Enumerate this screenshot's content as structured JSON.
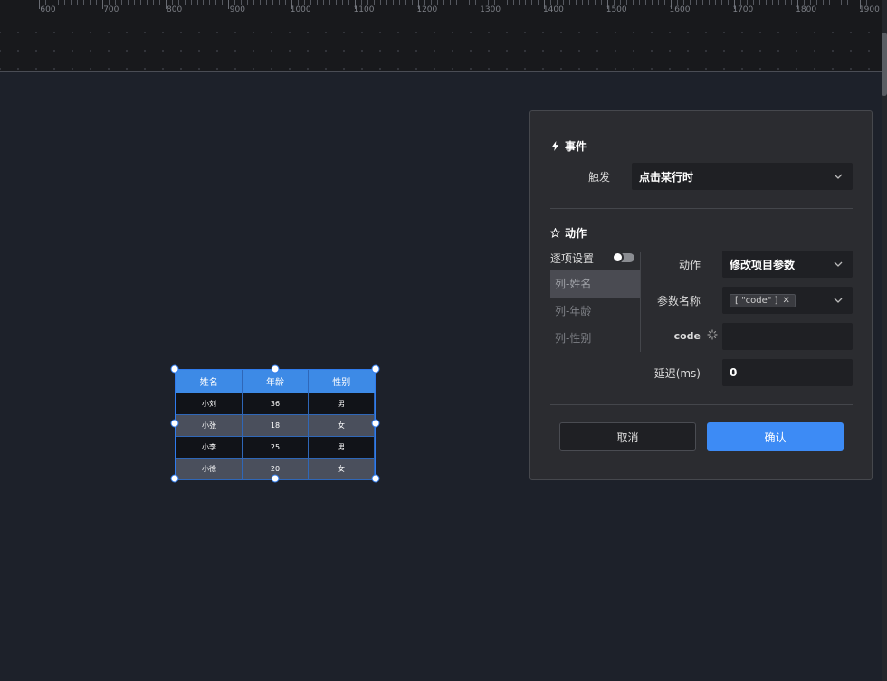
{
  "ruler": {
    "labels": [
      "600",
      "700",
      "800",
      "900",
      "1000",
      "1100",
      "1200",
      "1300",
      "1400",
      "1500",
      "1600",
      "1700",
      "1800",
      "1900"
    ]
  },
  "table_widget": {
    "headers": [
      "姓名",
      "年龄",
      "性别"
    ],
    "rows": [
      [
        "小刘",
        "36",
        "男"
      ],
      [
        "小张",
        "18",
        "女"
      ],
      [
        "小李",
        "25",
        "男"
      ],
      [
        "小徐",
        "20",
        "女"
      ]
    ]
  },
  "dialog": {
    "event_title": "事件",
    "trigger_label": "触发",
    "trigger_value": "点击某行时",
    "action_title": "动作",
    "per_item_label": "逐项设置",
    "columns": [
      "列-姓名",
      "列-年龄",
      "列-性别"
    ],
    "action_label": "动作",
    "action_value": "修改项目参数",
    "param_name_label": "参数名称",
    "param_tag": "[ \"code\" ]",
    "code_label": "code",
    "code_value": "",
    "delay_label": "延迟(ms)",
    "delay_value": "0",
    "cancel_label": "取消",
    "confirm_label": "确认"
  }
}
